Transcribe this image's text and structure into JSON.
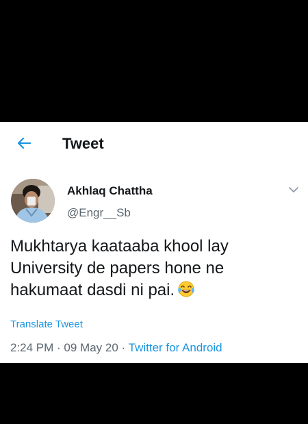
{
  "header": {
    "title": "Tweet"
  },
  "author": {
    "name": "Akhlaq Chattha",
    "handle": "@Engr__Sb"
  },
  "tweet": {
    "lines": [
      "Mukhtarya kaataaba khool lay",
      "University de papers hone ne",
      "hakumaat dasdi ni pai."
    ],
    "emoji": "face-with-tears-of-joy"
  },
  "translate_label": "Translate Tweet",
  "meta": {
    "time": "2:24 PM",
    "sep1": " · ",
    "date": "09 May 20",
    "sep2": " · ",
    "source": "Twitter for Android"
  },
  "colors": {
    "accent": "#1b95e0",
    "text": "#14171a",
    "muted": "#5b6770",
    "background": "#000000"
  },
  "icons": {
    "back": "back-arrow-icon",
    "menu": "chevron-down-icon"
  }
}
